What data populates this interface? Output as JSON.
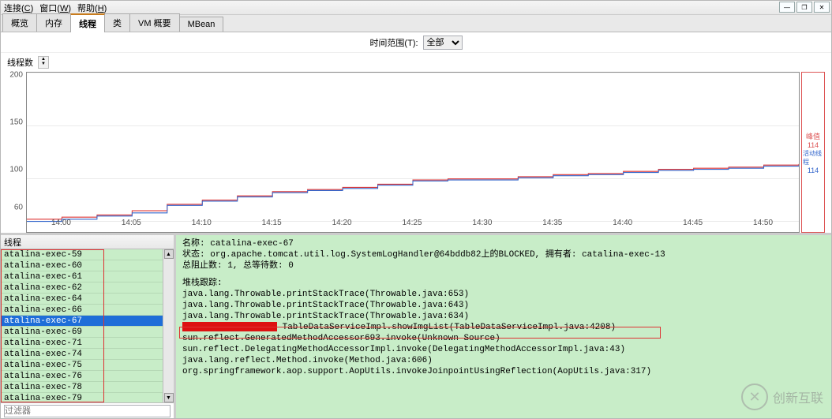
{
  "menubar": {
    "connect": "连接",
    "connect_key": "C",
    "window": "窗口",
    "window_key": "W",
    "help": "帮助",
    "help_key": "H"
  },
  "tabs": [
    "概览",
    "内存",
    "线程",
    "类",
    "VM 概要",
    "MBean"
  ],
  "active_tab": 2,
  "filter": {
    "label": "时间范围(T):",
    "selected": "全部"
  },
  "chart": {
    "label": "线程数",
    "legend": {
      "peak_label": "峰值",
      "peak_value": "114",
      "live_label": "活动线程",
      "live_value": "114"
    }
  },
  "chart_data": {
    "type": "line",
    "xlabel": "",
    "ylabel": "",
    "ylim": [
      50,
      200
    ],
    "yticks": [
      60,
      100,
      150,
      200
    ],
    "categories": [
      "14:00",
      "14:05",
      "14:10",
      "14:15",
      "14:20",
      "14:25",
      "14:30",
      "14:35",
      "14:40",
      "14:45",
      "14:50"
    ],
    "series": [
      {
        "name": "峰值",
        "values": [
          62,
          64,
          66,
          70,
          76,
          80,
          84,
          88,
          90,
          92,
          95,
          99,
          100,
          100,
          102,
          104,
          105,
          107,
          109,
          110,
          111,
          113,
          114
        ]
      },
      {
        "name": "活动线程",
        "values": [
          60,
          62,
          65,
          68,
          75,
          79,
          83,
          87,
          89,
          91,
          94,
          98,
          99,
          99,
          101,
          103,
          104,
          106,
          108,
          109,
          110,
          112,
          113
        ]
      }
    ]
  },
  "threads": {
    "header": "线程",
    "items": [
      "atalina-exec-59",
      "atalina-exec-60",
      "atalina-exec-61",
      "atalina-exec-62",
      "atalina-exec-64",
      "atalina-exec-66",
      "atalina-exec-67",
      "atalina-exec-69",
      "atalina-exec-71",
      "atalina-exec-74",
      "atalina-exec-75",
      "atalina-exec-76",
      "atalina-exec-78",
      "atalina-exec-79"
    ],
    "selected_index": 6,
    "filter_placeholder": "过滤器"
  },
  "detail": {
    "name_label": "名称:",
    "name_value": "catalina-exec-67",
    "state_label": "状态:",
    "state_value": "org.apache.tomcat.util.log.SystemLogHandler@64bddb82上的BLOCKED, 拥有者: catalina-exec-13",
    "block_label": "总阻止数:",
    "block_value": "1, 总等待数: 0",
    "stack_label": "堆栈跟踪:",
    "stack": [
      "java.lang.Throwable.printStackTrace(Throwable.java:653)",
      "java.lang.Throwable.printStackTrace(Throwable.java:643)",
      "java.lang.Throwable.printStackTrace(Throwable.java:634)",
      "TableDataServiceImpl.showImgList(TableDataServiceImpl.java:4208)",
      "sun.reflect.GeneratedMethodAccessor693.invoke(Unknown Source)",
      "sun.reflect.DelegatingMethodAccessorImpl.invoke(DelegatingMethodAccessorImpl.java:43)",
      "java.lang.reflect.Method.invoke(Method.java:606)",
      "org.springframework.aop.support.AopUtils.invokeJoinpointUsingReflection(AopUtils.java:317)"
    ]
  },
  "watermark": {
    "text": "创新互联"
  }
}
